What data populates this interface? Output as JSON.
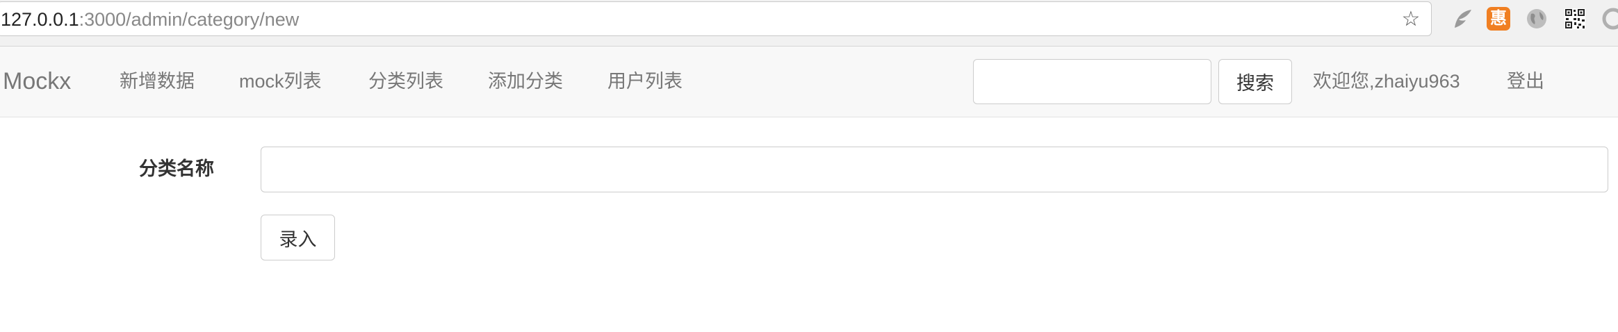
{
  "browser": {
    "url_host": "127.0.0.1",
    "url_path": ":3000/admin/category/new",
    "bookmark_icon": "star-icon",
    "extensions": [
      "feather-icon",
      "orange-extension-icon",
      "globe-icon",
      "qr-code-icon",
      "partial-extension-icon"
    ],
    "extension_orange_glyph": "惠"
  },
  "navbar": {
    "brand": "Mockx",
    "items": [
      {
        "label": "新增数据"
      },
      {
        "label": "mock列表"
      },
      {
        "label": "分类列表"
      },
      {
        "label": "添加分类"
      },
      {
        "label": "用户列表"
      }
    ],
    "search": {
      "value": "",
      "placeholder": ""
    },
    "search_button": "搜索",
    "welcome": "欢迎您,zhaiyu963",
    "logout": "登出"
  },
  "form": {
    "label": "分类名称",
    "input": {
      "value": "",
      "placeholder": ""
    },
    "submit": "录入"
  },
  "colors": {
    "navbar_bg": "#f8f8f8",
    "nav_text": "#777777",
    "extension_orange": "#f07f22"
  }
}
